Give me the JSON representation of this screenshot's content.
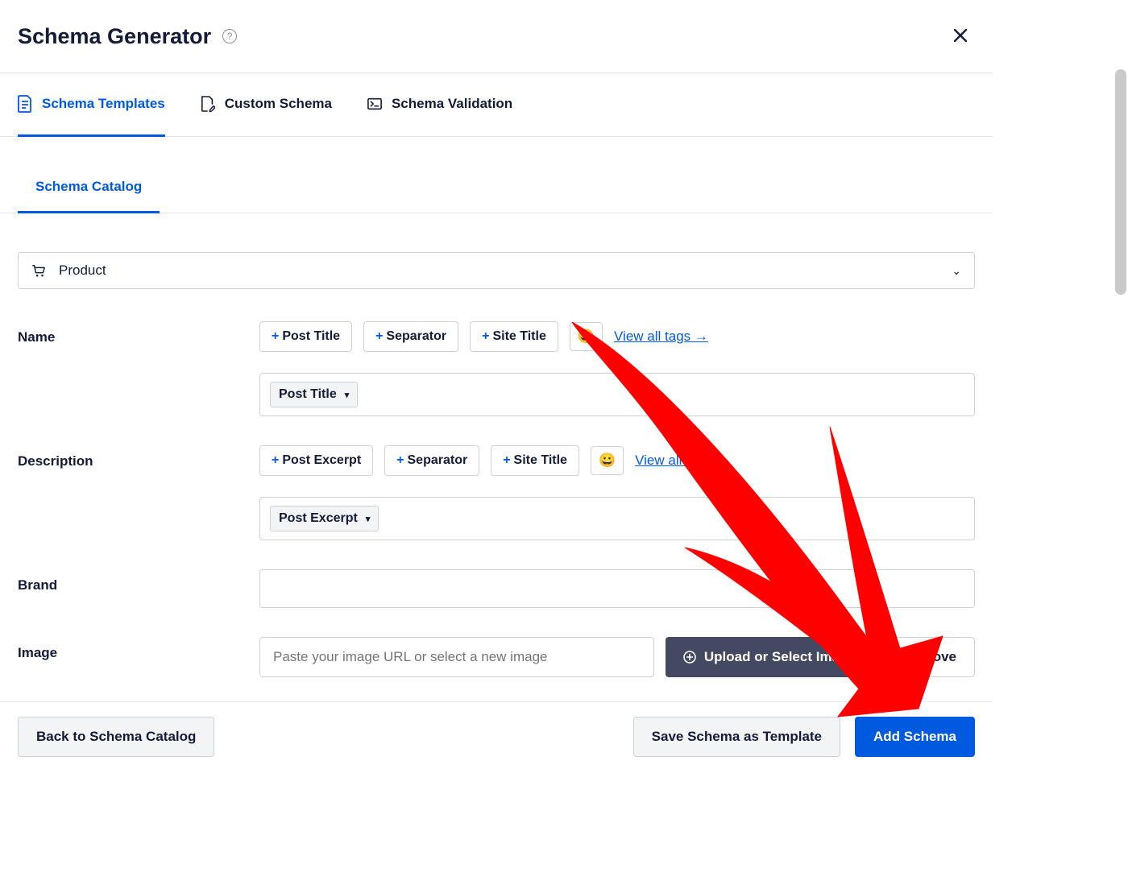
{
  "header": {
    "title": "Schema Generator"
  },
  "primary_tabs": [
    {
      "label": "Schema Templates",
      "active": true
    },
    {
      "label": "Custom Schema",
      "active": false
    },
    {
      "label": "Schema Validation",
      "active": false
    }
  ],
  "secondary_tabs": [
    {
      "label": "Schema Catalog",
      "active": true
    }
  ],
  "schema_type": {
    "selected": "Product"
  },
  "fields": {
    "name": {
      "label": "Name",
      "tags": [
        "Post Title",
        "Separator",
        "Site Title"
      ],
      "view_all": "View all tags →",
      "value_chip": "Post Title"
    },
    "description": {
      "label": "Description",
      "tags": [
        "Post Excerpt",
        "Separator",
        "Site Title"
      ],
      "view_all": "View all tags →",
      "value_chip": "Post Excerpt"
    },
    "brand": {
      "label": "Brand"
    },
    "image": {
      "label": "Image",
      "placeholder": "Paste your image URL or select a new image",
      "upload_label": "Upload or Select Image",
      "remove_label": "Remove"
    }
  },
  "footer": {
    "back": "Back to Schema Catalog",
    "save_template": "Save Schema as Template",
    "add_schema": "Add Schema"
  }
}
